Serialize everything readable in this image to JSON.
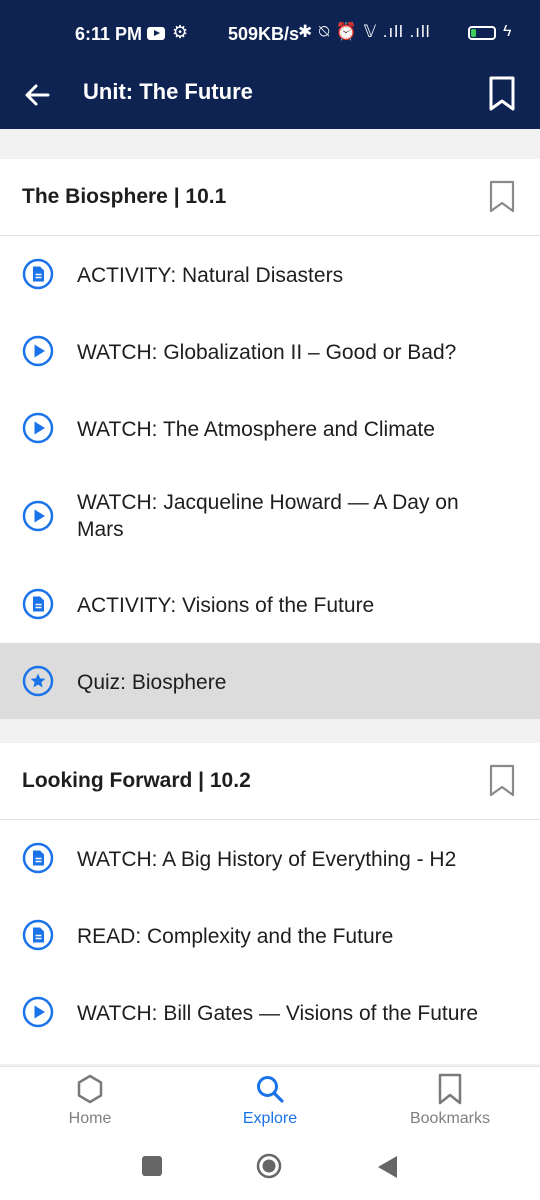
{
  "status_bar": {
    "time": "6:11 PM",
    "speed": "509KB/s",
    "icons_text": "✱ ⍉ ⏰ 𝕍 .ıll .ıll",
    "battery": "23"
  },
  "app_bar": {
    "title": "Unit: The Future"
  },
  "sections": [
    {
      "title": "The Biosphere | 10.1",
      "items": [
        {
          "type": "document",
          "label": "ACTIVITY: Natural Disasters"
        },
        {
          "type": "play",
          "label": "WATCH: Globalization II – Good or Bad?"
        },
        {
          "type": "play",
          "label": "WATCH: The Atmosphere and Climate"
        },
        {
          "type": "play",
          "label": "WATCH: Jacqueline Howard — A Day on Mars"
        },
        {
          "type": "document",
          "label": "ACTIVITY: Visions of the Future"
        },
        {
          "type": "star",
          "label": "Quiz: Biosphere",
          "selected": true
        }
      ]
    },
    {
      "title": "Looking Forward | 10.2",
      "items": [
        {
          "type": "document",
          "label": "WATCH: A Big History of Everything - H2"
        },
        {
          "type": "document",
          "label": "READ: Complexity and the Future"
        },
        {
          "type": "play",
          "label": "WATCH: Bill Gates — Visions of the Future"
        }
      ]
    }
  ],
  "bottom_nav": {
    "home": "Home",
    "explore": "Explore",
    "bookmarks": "Bookmarks",
    "active": "explore"
  },
  "colors": {
    "header_bg": "#0e2352",
    "accent": "#1a73e8",
    "selected_row": "#dcdcdc"
  }
}
